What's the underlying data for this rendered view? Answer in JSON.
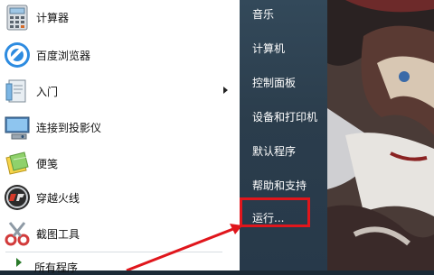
{
  "programs": [
    {
      "label": "计算器",
      "icon": "calculator-icon"
    },
    {
      "label": "百度浏览器",
      "icon": "baidu-browser-icon"
    },
    {
      "label": "入门",
      "icon": "getting-started-icon",
      "has_submenu": true
    },
    {
      "label": "连接到投影仪",
      "icon": "projector-icon"
    },
    {
      "label": "便笺",
      "icon": "sticky-notes-icon"
    },
    {
      "label": "穿越火线",
      "icon": "crossfire-icon"
    },
    {
      "label": "截图工具",
      "icon": "snipping-tool-icon"
    }
  ],
  "all_programs_label": "所有程序",
  "right_items": [
    {
      "label": "音乐"
    },
    {
      "label": "计算机"
    },
    {
      "label": "控制面板"
    },
    {
      "label": "设备和打印机"
    },
    {
      "label": "默认程序"
    },
    {
      "label": "帮助和支持"
    },
    {
      "label": "运行..."
    }
  ],
  "colors": {
    "highlight": "#e0161c",
    "right_pane": "#2b3d4c"
  }
}
